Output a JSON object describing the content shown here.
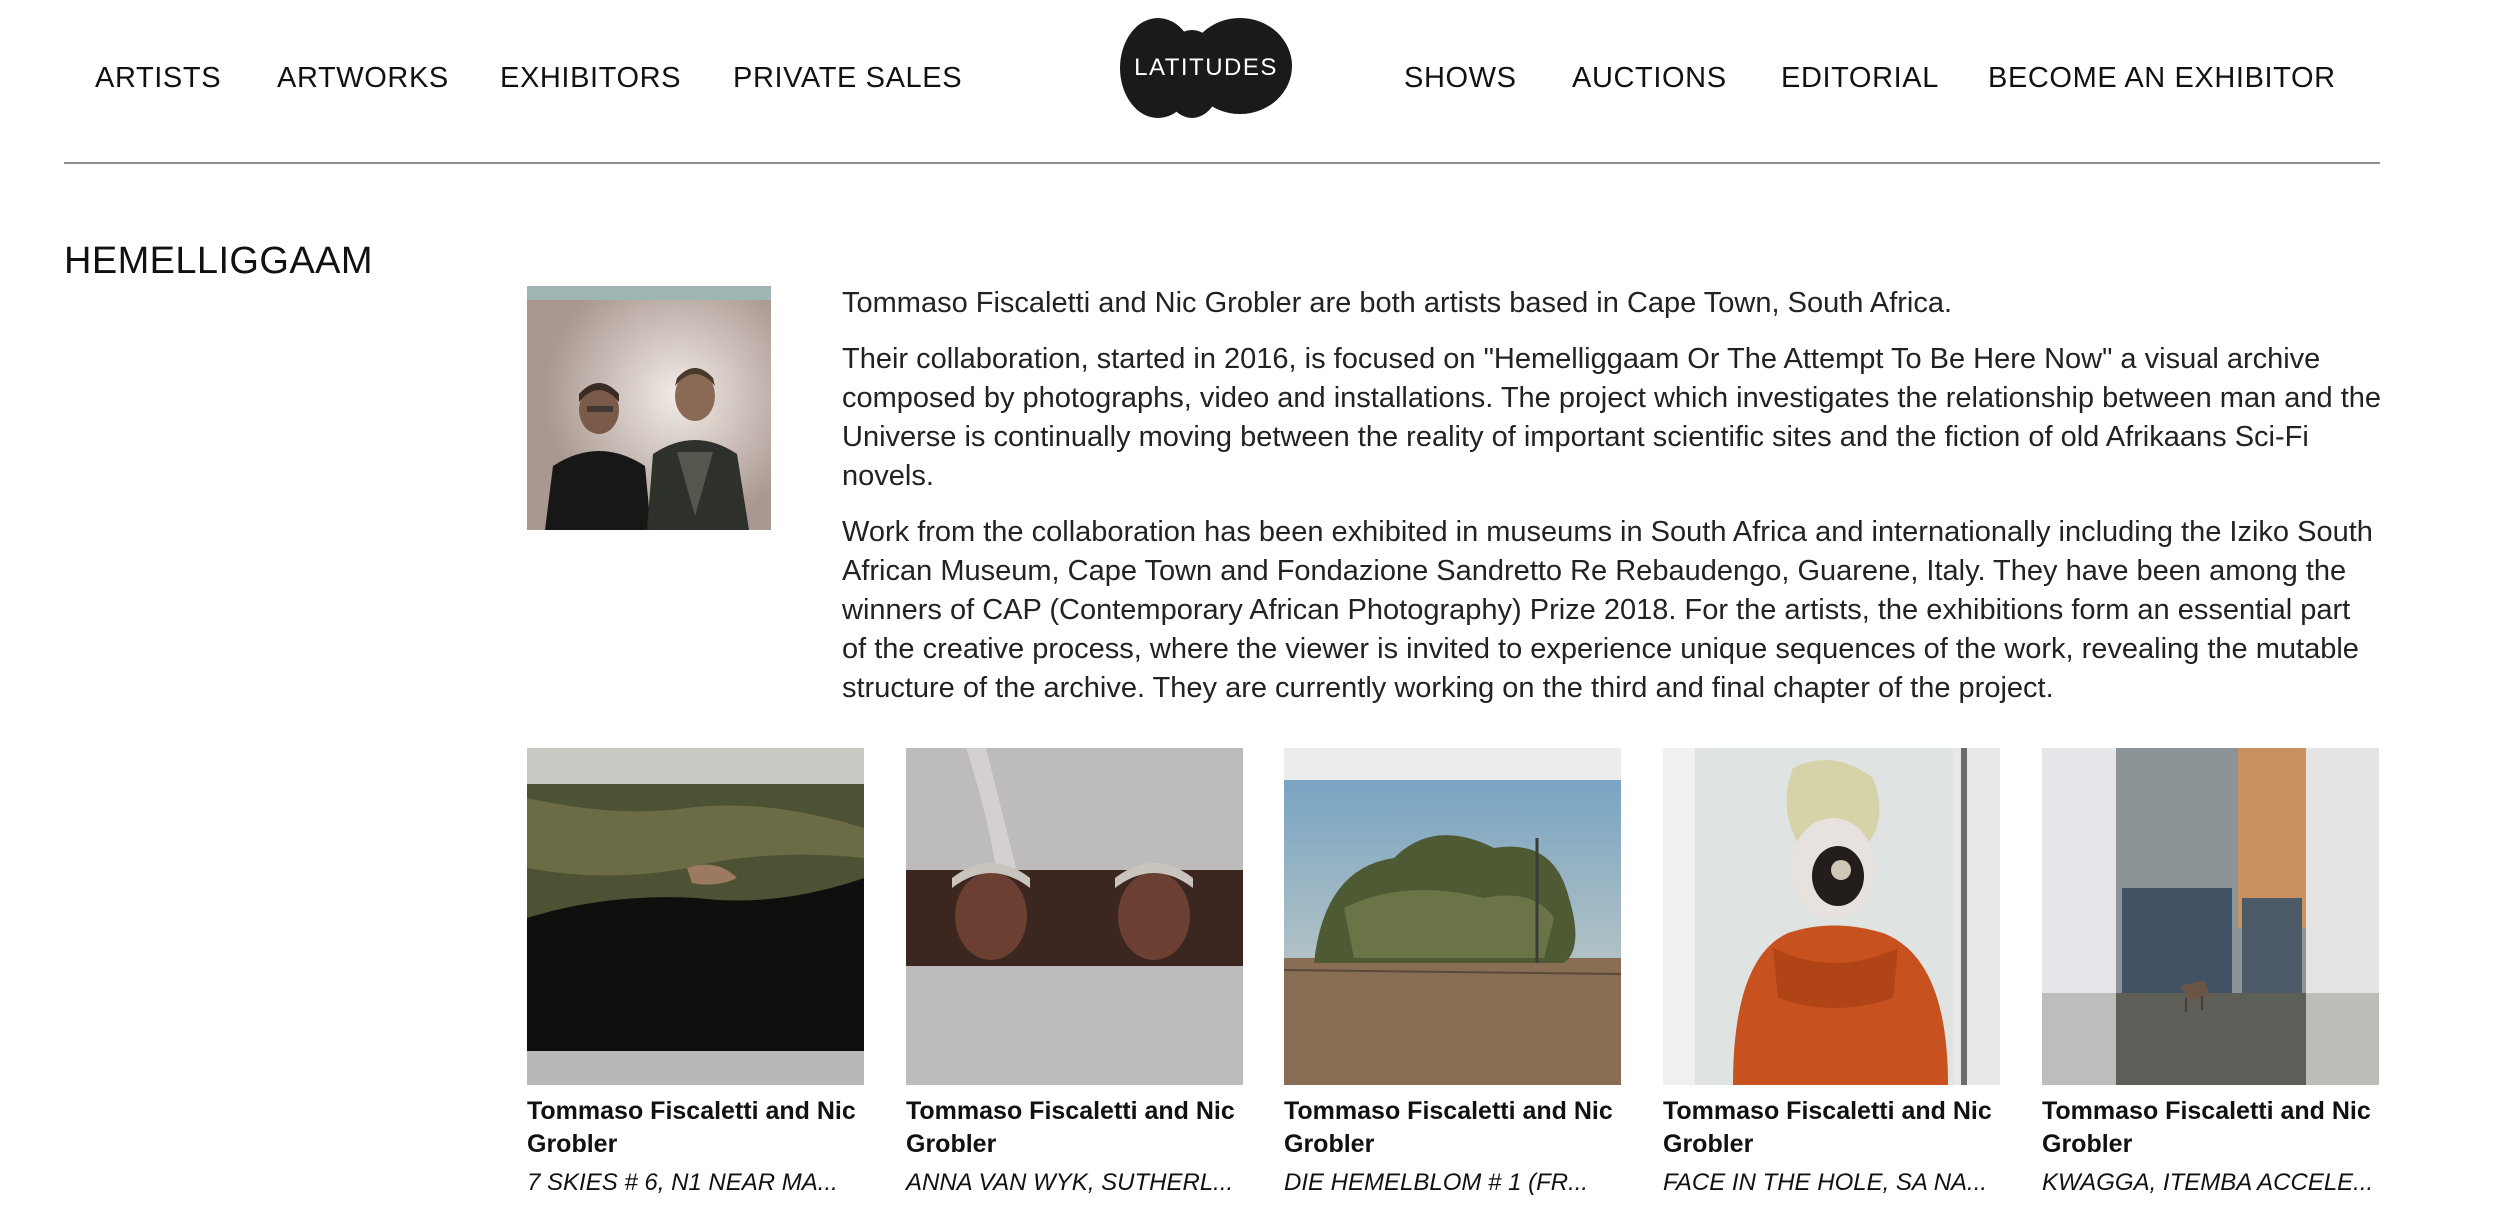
{
  "nav_left": [
    "ARTISTS",
    "ARTWORKS",
    "EXHIBITORS",
    "PRIVATE SALES"
  ],
  "nav_right": [
    "SHOWS",
    "AUCTIONS",
    "EDITORIAL",
    "BECOME AN EXHIBITOR"
  ],
  "logo": {
    "text": "LATITUDES",
    "color": "#1a1a1a"
  },
  "artist": {
    "name": "HEMELLIGGAAM",
    "bio": [
      "Tommaso Fiscaletti and Nic Grobler are both artists based in Cape Town, South Africa.",
      "Their collaboration, started in 2016, is focused on \"Hemelliggaam Or The Attempt To Be Here Now\" a visual archive composed by photographs, video and installations. The project which investigates the relationship between man and the Universe is continually moving between the reality of important scientific sites and the fiction of old Afrikaans Sci-Fi novels.",
      "Work from the collaboration has been exhibited in museums in South Africa and internationally including the Iziko South African Museum, Cape Town and Fondazione Sandretto Re Rebaudengo, Guarene, Italy. They have been among the winners of CAP (Contemporary African Photography) Prize 2018. For the artists, the exhibitions form an essential part of the creative process, where the viewer is invited to experience unique sequences of the work, revealing the mutable structure of the archive. They are currently working on the third and final chapter of the project."
    ]
  },
  "artworks": [
    {
      "artist": "Tommaso Fiscaletti and Nic Grobler",
      "title": "7 SKIES # 6, N1 NEAR MA..."
    },
    {
      "artist": "Tommaso Fiscaletti and Nic Grobler",
      "title": "ANNA VAN WYK, SUTHERL..."
    },
    {
      "artist": "Tommaso Fiscaletti and Nic Grobler",
      "title": "DIE HEMELBLOM # 1 (FR..."
    },
    {
      "artist": "Tommaso Fiscaletti and Nic Grobler",
      "title": "FACE IN THE HOLE, SA NA..."
    },
    {
      "artist": "Tommaso Fiscaletti and Nic Grobler",
      "title": "KWAGGA, ITEMBA ACCELE..."
    }
  ]
}
